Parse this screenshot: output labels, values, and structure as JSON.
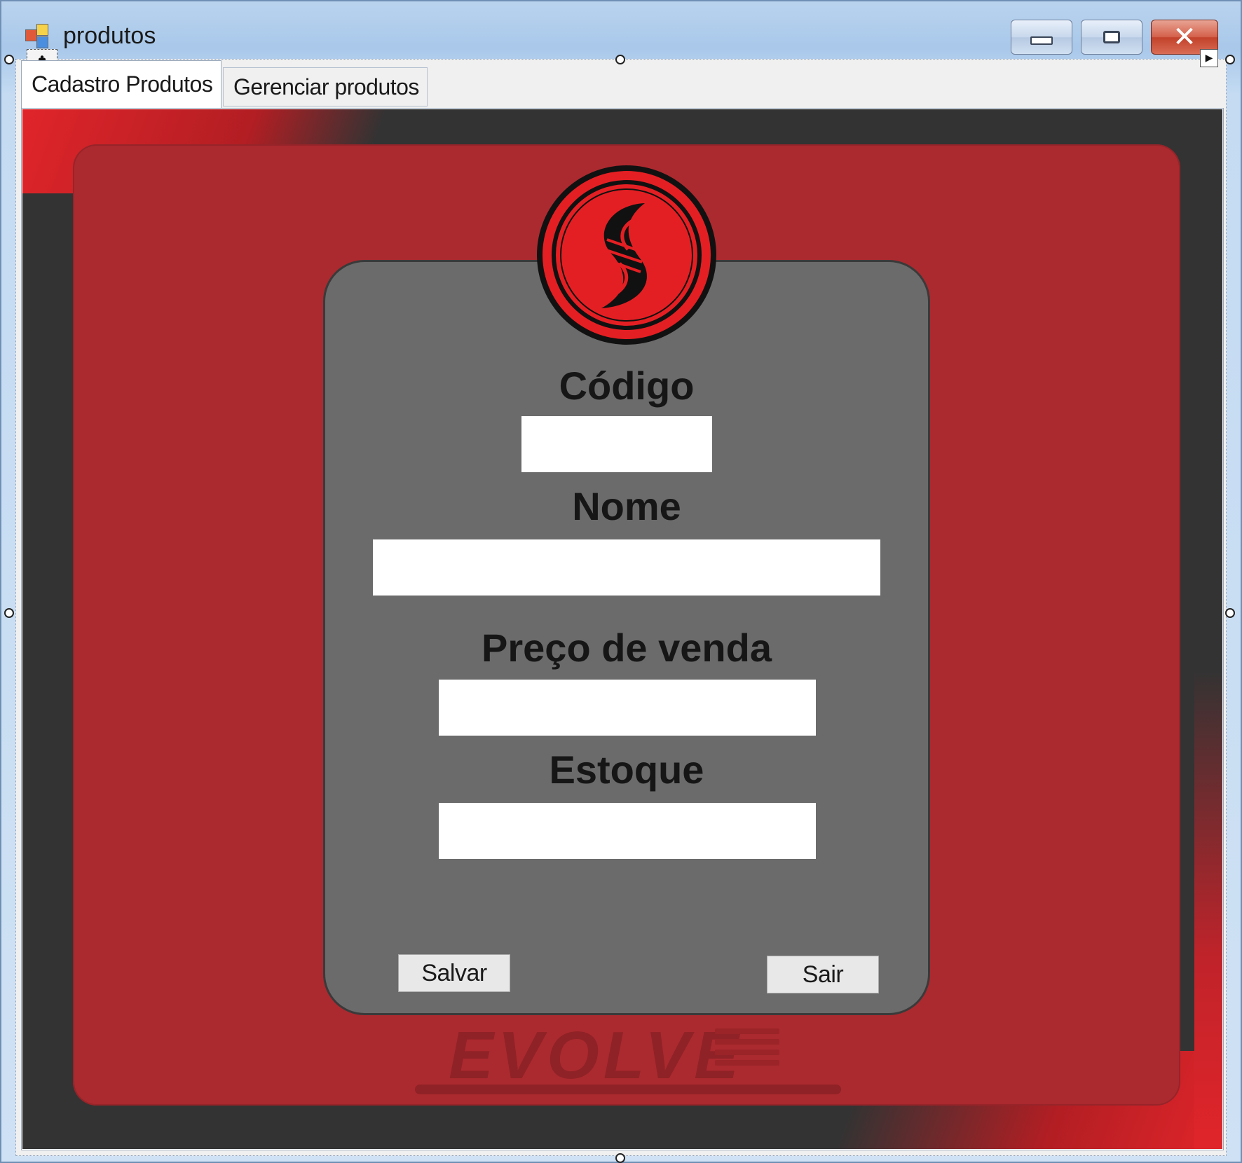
{
  "window": {
    "title": "produtos",
    "icon": "app-form-icon",
    "controls": [
      "minimize-icon",
      "maximize-icon",
      "close-icon"
    ]
  },
  "tabs": [
    {
      "label": "Cadastro Produtos",
      "active": true
    },
    {
      "label": "Gerenciar produtos",
      "active": false
    }
  ],
  "form": {
    "logo": "brand-s-logo",
    "fields": [
      {
        "label": "Código",
        "value": "",
        "placeholder": ""
      },
      {
        "label": "Nome",
        "value": "",
        "placeholder": ""
      },
      {
        "label": "Preço de venda",
        "value": "",
        "placeholder": ""
      },
      {
        "label": "Estoque",
        "value": "",
        "placeholder": ""
      }
    ],
    "buttons": {
      "save_label": "Salvar",
      "exit_label": "Sair"
    }
  },
  "background": {
    "watermark_text": "EVOLVE",
    "colors": {
      "panel_red": "#ab2a2f",
      "dark_frame": "#333333",
      "card_gray": "#6b6b6b",
      "accent_red": "#e0252a"
    }
  },
  "designer": {
    "move_glyph": "move-icon",
    "smart_tag": "smart-tag-arrow-icon"
  }
}
